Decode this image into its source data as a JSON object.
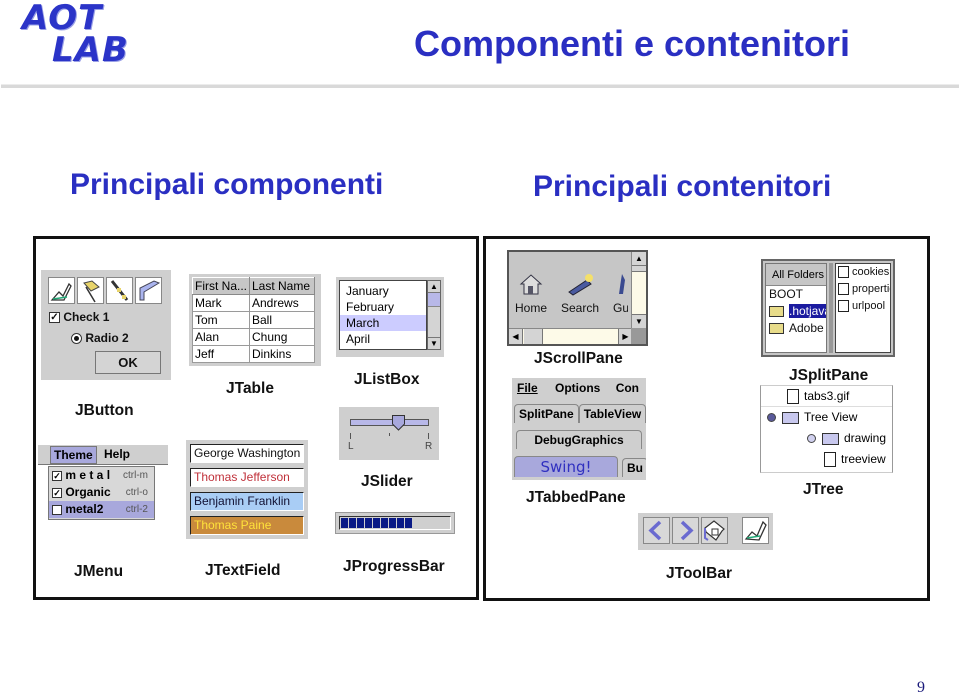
{
  "header": {
    "logo_line1": "AOT",
    "logo_line2": "LAB",
    "title": "Componenti e contenitori"
  },
  "sections": {
    "components_title": "Principali componenti",
    "containers_title": "Principali contenitori"
  },
  "components": {
    "jbutton": {
      "caption": "JButton",
      "checkbox_label": "Check 1",
      "checkbox_checked": true,
      "radio_label": "Radio 2",
      "radio_selected": true,
      "ok_label": "OK",
      "icon_buttons": [
        "draw-icon",
        "flag-icon",
        "pencil-icon",
        "frame-icon"
      ]
    },
    "jtable": {
      "caption": "JTable",
      "columns": [
        "First Na...",
        "Last Name"
      ],
      "rows": [
        [
          "Mark",
          "Andrews"
        ],
        [
          "Tom",
          "Ball"
        ],
        [
          "Alan",
          "Chung"
        ],
        [
          "Jeff",
          "Dinkins"
        ]
      ]
    },
    "jlistbox": {
      "caption": "JListBox",
      "items": [
        "January",
        "February",
        "March",
        "April"
      ],
      "selected": "March"
    },
    "jslider": {
      "caption": "JSlider",
      "min_label": "L",
      "max_label": "R",
      "value_fraction": 0.62
    },
    "jmenu": {
      "caption": "JMenu",
      "menubar": [
        "Theme",
        "Help"
      ],
      "items": [
        {
          "label": "m e t a l",
          "checked": true,
          "accelerator": "ctrl-m"
        },
        {
          "label": "Organic",
          "checked": true,
          "accelerator": "ctrl-o"
        },
        {
          "label": "metal2",
          "checked": false,
          "accelerator": "ctrl-2"
        }
      ]
    },
    "jtextfield": {
      "caption": "JTextField",
      "fields": [
        {
          "value": "George Washington",
          "fg": "#111111",
          "bg": "#ffffff"
        },
        {
          "value": "Thomas Jefferson",
          "fg": "#c0303a",
          "bg": "#ffffff"
        },
        {
          "value": "Benjamin Franklin",
          "fg": "#111133",
          "bg": "#a9cdf5"
        },
        {
          "value": "Thomas Paine",
          "fg": "#ffe23a",
          "bg": "#c98a3c"
        }
      ]
    },
    "jprogressbar": {
      "caption": "JProgressBar",
      "value_fraction": 0.72,
      "color": "#0a1a86"
    }
  },
  "containers": {
    "jscrollpane": {
      "caption": "JScrollPane",
      "items": [
        "Home",
        "Search",
        "Gu"
      ]
    },
    "jtabbedpane": {
      "caption": "JTabbedPane",
      "menu": [
        "File",
        "Options",
        "Con"
      ],
      "tab_row1": [
        "SplitPane",
        "TableView"
      ],
      "tab_row2": [
        "DebugGraphics"
      ],
      "tab_row3": [
        "Swing!",
        "Bu"
      ]
    },
    "jsplitpane": {
      "caption": "JSplitPane",
      "left_header": "All Folders",
      "left_items": [
        "BOOT",
        ".hotjava",
        "Adobe"
      ],
      "left_selected": ".hotjava",
      "right_items": [
        "cookies",
        "propertie",
        "urlpool"
      ]
    },
    "jtree": {
      "caption": "JTree",
      "nodes": [
        {
          "label": "tabs3.gif",
          "type": "file",
          "level": 1
        },
        {
          "label": "Tree View",
          "type": "folder",
          "level": 0
        },
        {
          "label": "drawing",
          "type": "folder",
          "level": 2
        },
        {
          "label": "treeview",
          "type": "file",
          "level": 3
        }
      ]
    },
    "jtoolbar": {
      "caption": "JToolBar",
      "buttons": [
        "back-icon",
        "forward-icon",
        "home-icon",
        "draw-icon"
      ]
    }
  },
  "footer": {
    "page_number": "9"
  },
  "colors": {
    "title_blue": "#2a2fc2",
    "selection": "#ccccff",
    "panel_gray": "#cfcfcf"
  }
}
